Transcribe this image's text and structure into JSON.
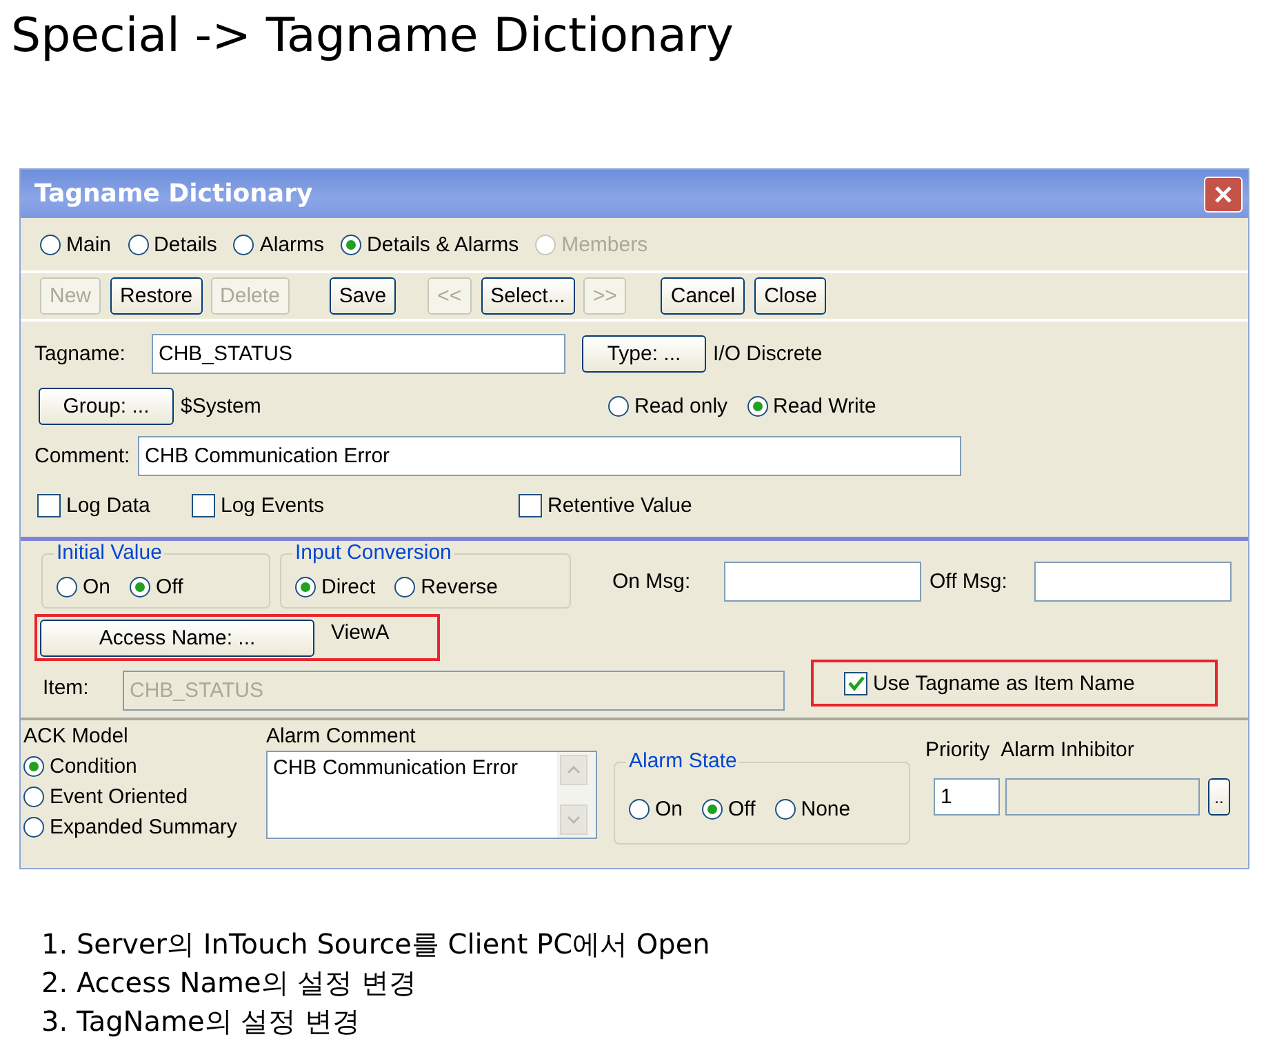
{
  "slide_title": "Special -> Tagname Dictionary",
  "dialog": {
    "title": "Tagname Dictionary",
    "views": [
      {
        "label": "Main",
        "selected": false,
        "disabled": false
      },
      {
        "label": "Details",
        "selected": false,
        "disabled": false
      },
      {
        "label": "Alarms",
        "selected": false,
        "disabled": false
      },
      {
        "label": "Details & Alarms",
        "selected": true,
        "disabled": false
      },
      {
        "label": "Members",
        "selected": false,
        "disabled": true
      }
    ],
    "toolbar": [
      {
        "label": "New",
        "disabled": true
      },
      {
        "label": "Restore",
        "disabled": false
      },
      {
        "label": "Delete",
        "disabled": true
      },
      {
        "label": "Save",
        "disabled": false
      },
      {
        "label": "<<",
        "disabled": true
      },
      {
        "label": "Select...",
        "disabled": false
      },
      {
        "label": ">>",
        "disabled": true
      },
      {
        "label": "Cancel",
        "disabled": false
      },
      {
        "label": "Close",
        "disabled": false
      }
    ],
    "tagname": {
      "label": "Tagname:",
      "value": "CHB_STATUS"
    },
    "type_button": "Type: ...",
    "type_value": "I/O Discrete",
    "group_button": "Group: ...",
    "group_value": "$System",
    "access_mode": [
      {
        "label": "Read only",
        "selected": false
      },
      {
        "label": "Read Write",
        "selected": true
      }
    ],
    "comment": {
      "label": "Comment:",
      "value": "CHB Communication Error"
    },
    "options": [
      {
        "label": "Log Data",
        "checked": false
      },
      {
        "label": "Log Events",
        "checked": false
      },
      {
        "label": "Retentive Value",
        "checked": false
      }
    ],
    "initial_value": {
      "title": "Initial Value",
      "options": [
        {
          "label": "On",
          "selected": false
        },
        {
          "label": "Off",
          "selected": true
        }
      ]
    },
    "input_conversion": {
      "title": "Input Conversion",
      "options": [
        {
          "label": "Direct",
          "selected": true
        },
        {
          "label": "Reverse",
          "selected": false
        }
      ]
    },
    "on_msg": {
      "label": "On Msg:"
    },
    "off_msg": {
      "label": "Off Msg:"
    },
    "access_name": {
      "button": "Access Name: ...",
      "value": "ViewA",
      "highlighted": true
    },
    "item": {
      "label": "Item:",
      "value": "CHB_STATUS",
      "disabled": true
    },
    "use_tagname": {
      "label": "Use Tagname as Item Name",
      "checked": true,
      "highlighted": true
    },
    "ack_model": {
      "title": "ACK Model",
      "options": [
        {
          "label": "Condition",
          "selected": true
        },
        {
          "label": "Event Oriented",
          "selected": false
        },
        {
          "label": "Expanded Summary",
          "selected": false
        }
      ]
    },
    "alarm_comment": {
      "label": "Alarm Comment",
      "value": "CHB Communication Error"
    },
    "alarm_state": {
      "title": "Alarm State",
      "options": [
        {
          "label": "On",
          "selected": false
        },
        {
          "label": "Off",
          "selected": true
        },
        {
          "label": "None",
          "selected": false
        }
      ]
    },
    "priority": {
      "label": "Priority",
      "value": "1"
    },
    "alarm_inhibitor": {
      "label": "Alarm Inhibitor",
      "button": ".."
    }
  },
  "notes": [
    "1. Server의 InTouch Source를 Client PC에서 Open",
    "2. Access Name의 설정 변경",
    "3. TagName의 설정 변경"
  ]
}
